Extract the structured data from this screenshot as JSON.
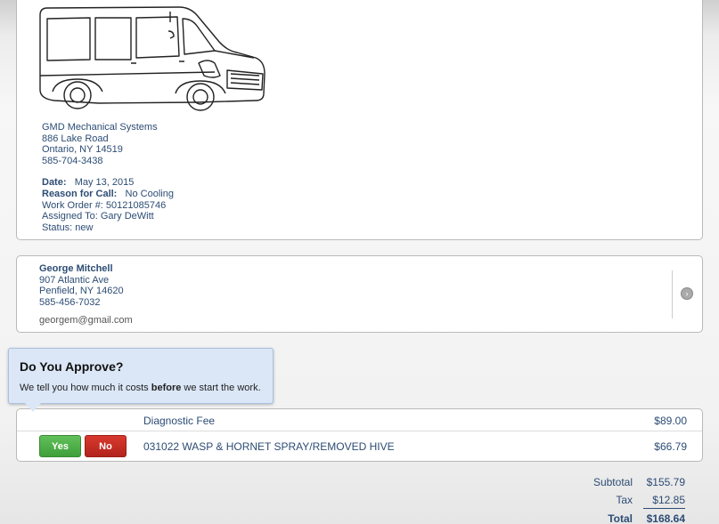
{
  "company": {
    "name": "GMD Mechanical Systems",
    "street": "886 Lake Road",
    "city": "Ontario, NY 14519",
    "phone": "585-704-3438",
    "date_label": "Date:",
    "date": "May 13, 2015",
    "reason_label": "Reason for Call:",
    "reason": "No Cooling",
    "work_order": "Work Order #: 50121085746",
    "assigned": "Assigned To: Gary DeWitt",
    "status": "Status: new"
  },
  "customer": {
    "name": "George Mitchell",
    "street": "907 Atlantic Ave",
    "city": "Penfield, NY 14620",
    "phone": "585-456-7032",
    "email": "georgem@gmail.com"
  },
  "tooltip": {
    "title": "Do You Approve?",
    "body_pre": "We tell you how much it costs ",
    "body_bold": "before",
    "body_post": " we start the work."
  },
  "items": [
    {
      "description": "Diagnostic Fee",
      "price": "$89.00"
    },
    {
      "description": "031022 WASP & HORNET SPRAY/REMOVED HIVE",
      "price": "$66.79"
    }
  ],
  "buttons": {
    "yes": "Yes",
    "no": "No"
  },
  "totals": {
    "subtotal_label": "Subtotal",
    "subtotal": "$155.79",
    "tax_label": "Tax",
    "tax": "$12.85",
    "total_label": "Total",
    "total": "$168.64"
  },
  "icons": {
    "van": "van-illustration",
    "arrow": "chevron-right-icon"
  },
  "colors": {
    "text": "#2c4c74",
    "yes": "#4caf44",
    "no": "#c62d23",
    "tooltip_bg": "#dbe7f7"
  }
}
